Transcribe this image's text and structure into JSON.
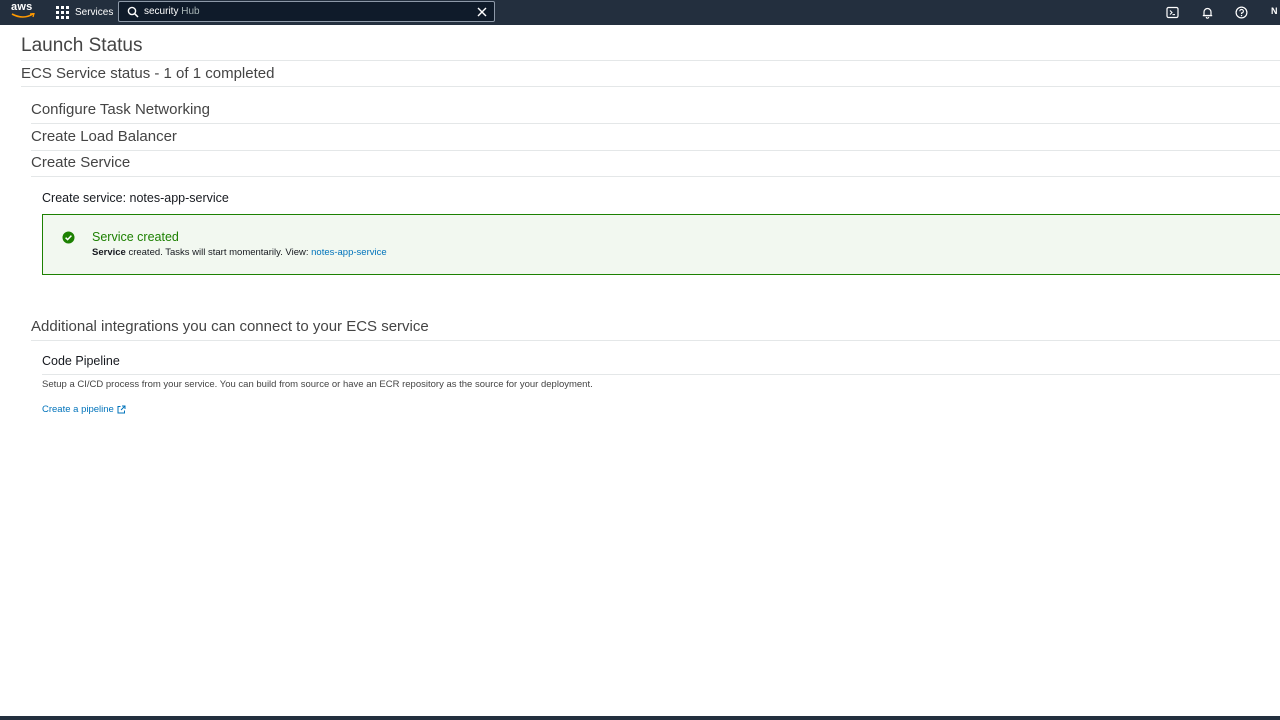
{
  "topnav": {
    "logo_text": "aws",
    "services_label": "Services",
    "search_query": "security",
    "search_query_rest": " Hub",
    "user_initial": "N",
    "icons": [
      "cloudshell-icon",
      "bell-icon",
      "help-icon"
    ]
  },
  "page": {
    "title": "Launch Status",
    "status": "ECS Service status - 1 of 1 completed",
    "steps": [
      "Configure Task Networking",
      "Create Load Balancer",
      "Create Service"
    ],
    "create_service_label": "Create service: notes-app-service"
  },
  "alert": {
    "title": "Service created",
    "body_bold": "Service",
    "body_text": " created. Tasks will start momentarily. View: ",
    "body_link": "notes-app-service",
    "color": "#1d8102"
  },
  "integrations": {
    "heading": "Additional integrations you can connect to your ECS service",
    "code_pipeline_title": "Code Pipeline",
    "code_pipeline_desc": "Setup a CI/CD process from your service. You can build from source or have an ECR repository as the source for your deployment.",
    "create_pipeline_link": "Create a pipeline"
  },
  "colors": {
    "nav_bg": "#232f3e",
    "link": "#0073bb",
    "success": "#1d8102"
  }
}
